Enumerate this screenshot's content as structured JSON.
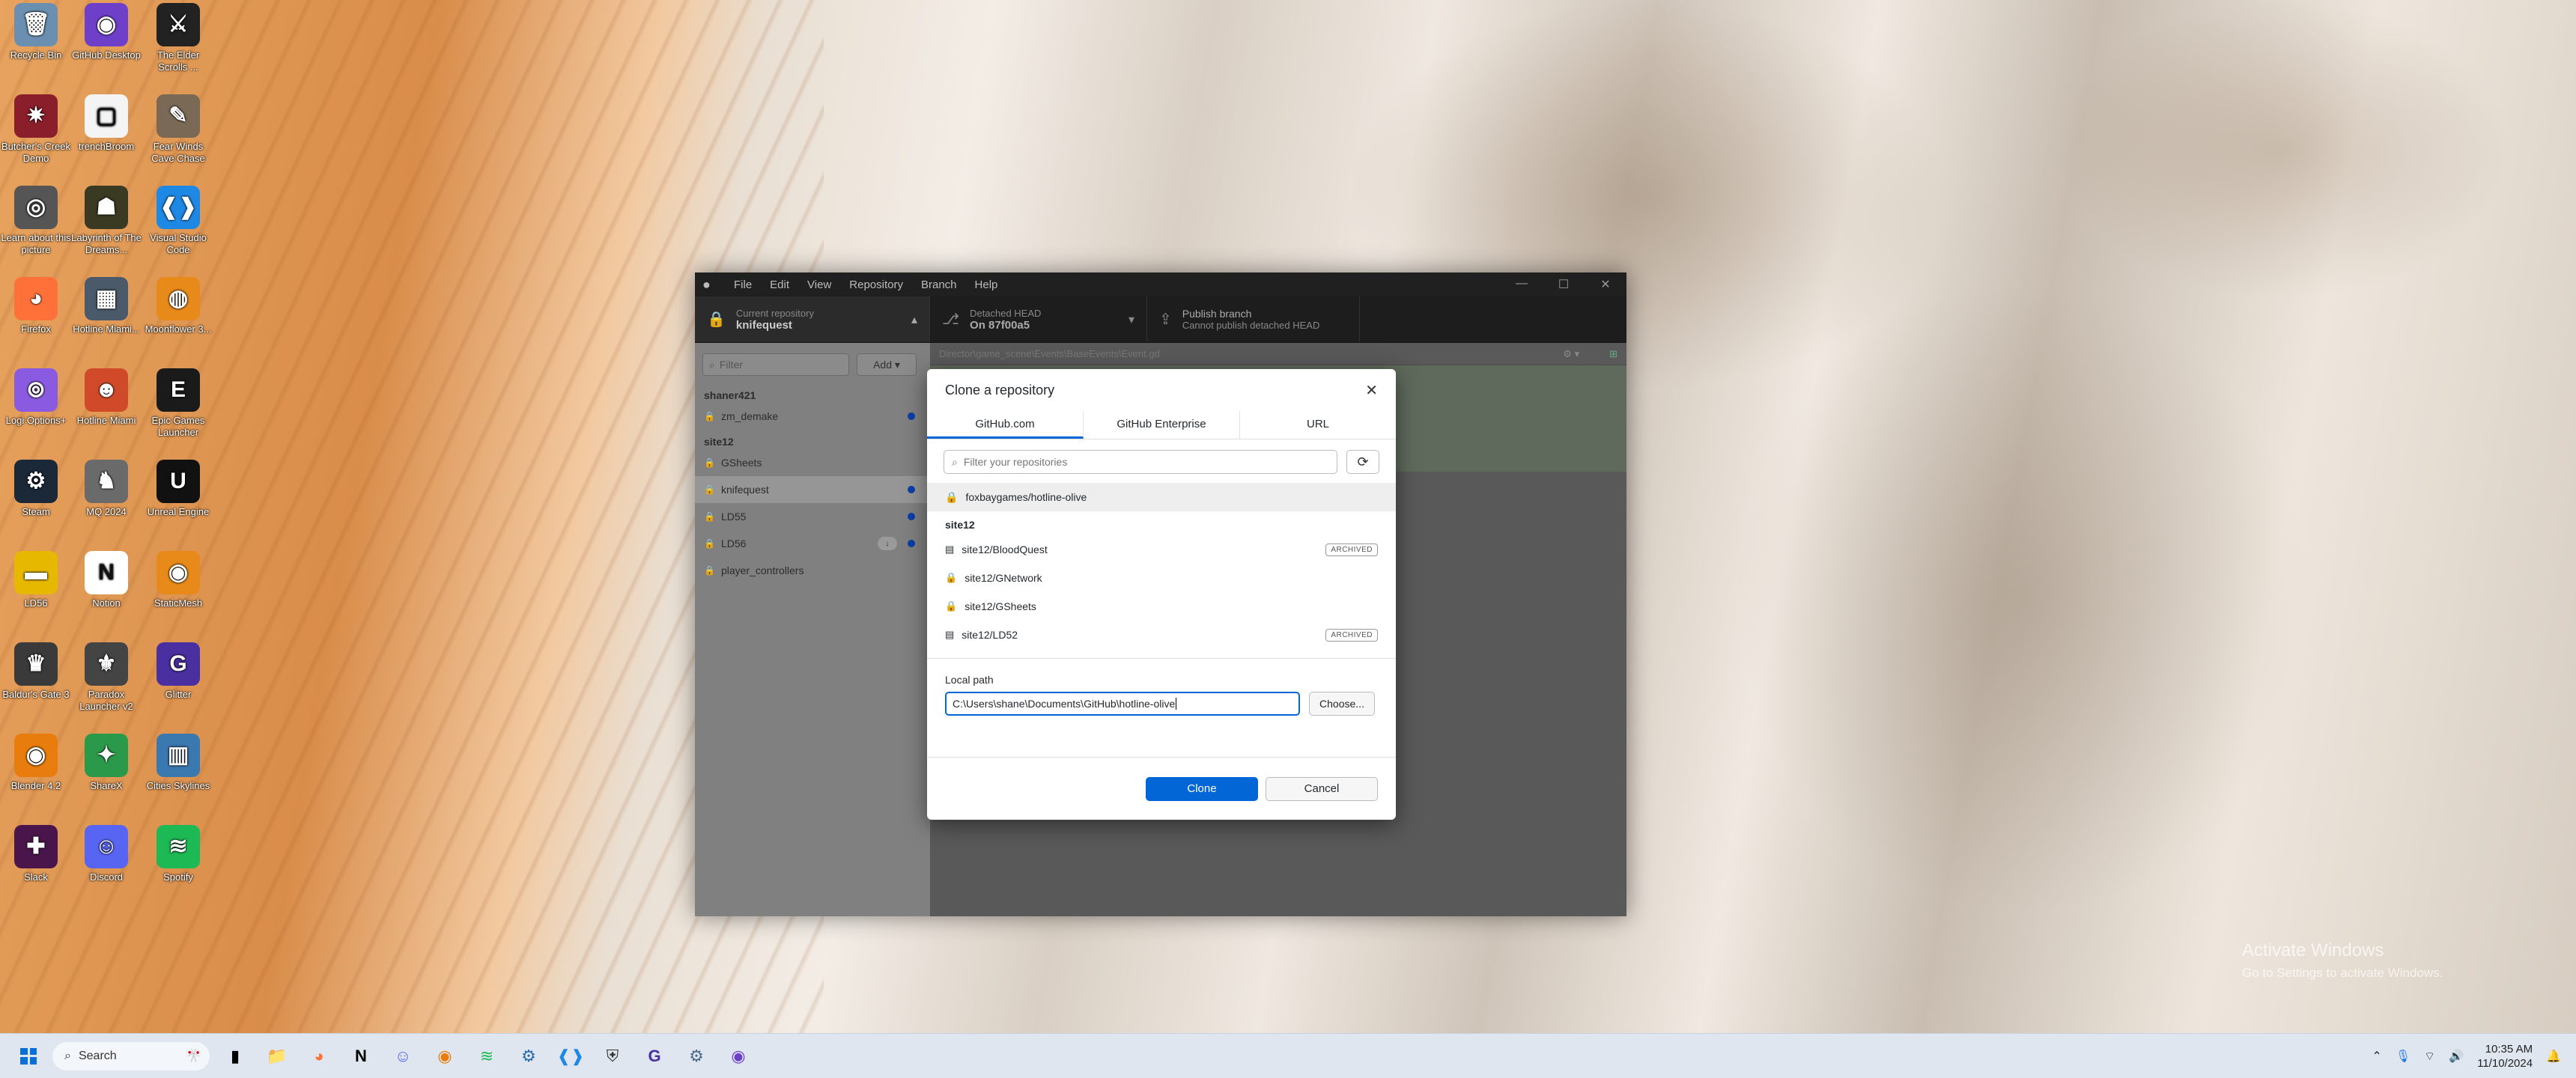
{
  "desktop": {
    "icons": [
      {
        "label": "Recycle Bin",
        "glyph": "🗑",
        "color": "#6a8fb0"
      },
      {
        "label": "GitHub Desktop",
        "glyph": "◉",
        "color": "#6e40c9"
      },
      {
        "label": "The Elder Scrolls ...",
        "glyph": "⚔",
        "color": "#222"
      },
      {
        "label": "Butcher's Creek Demo",
        "glyph": "✷",
        "color": "#8a1f2b"
      },
      {
        "label": "trenchBroom",
        "glyph": "▢",
        "color": "#f4f4f4"
      },
      {
        "label": "Fear Winds Cave Chase",
        "glyph": "✎",
        "color": "#7a6a55"
      },
      {
        "label": "Learn about this picture",
        "glyph": "◎",
        "color": "#555"
      },
      {
        "label": "Labyrinth of The Dreams...",
        "glyph": "☗",
        "color": "#3a3a22"
      },
      {
        "label": "Visual Studio Code",
        "glyph": "❰❱",
        "color": "#1e88e5"
      },
      {
        "label": "Firefox",
        "glyph": "◕",
        "color": "#ff7139"
      },
      {
        "label": "Hotline Miami...",
        "glyph": "▦",
        "color": "#4a5a6a"
      },
      {
        "label": "Moonflower 3...",
        "glyph": "◍",
        "color": "#e88a1a"
      },
      {
        "label": "Logi Options+",
        "glyph": "⊚",
        "color": "#8a5be0"
      },
      {
        "label": "Hotline Miami",
        "glyph": "☻",
        "color": "#d04a2a"
      },
      {
        "label": "Epic Games Launcher",
        "glyph": "E",
        "color": "#1a1a1a"
      },
      {
        "label": "Steam",
        "glyph": "⚙",
        "color": "#1b2838"
      },
      {
        "label": "MQ 2024",
        "glyph": "♞",
        "color": "#6a6a6a"
      },
      {
        "label": "Unreal Engine",
        "glyph": "U",
        "color": "#111"
      },
      {
        "label": "LD56",
        "glyph": "▬",
        "color": "#e6b800"
      },
      {
        "label": "Notion",
        "glyph": "N",
        "color": "#fff"
      },
      {
        "label": "StaticMesh",
        "glyph": "◉",
        "color": "#e88a1a"
      },
      {
        "label": "Baldur's Gate 3",
        "glyph": "♛",
        "color": "#3a3a3a"
      },
      {
        "label": "Paradox Launcher v2",
        "glyph": "⚜",
        "color": "#444"
      },
      {
        "label": "Glitter",
        "glyph": "G",
        "color": "#4a2fa0"
      },
      {
        "label": "Blender 4.2",
        "glyph": "◉",
        "color": "#e87d0d"
      },
      {
        "label": "ShareX",
        "glyph": "✦",
        "color": "#2a9a4a"
      },
      {
        "label": "Cities Skylines",
        "glyph": "▥",
        "color": "#3a78b0"
      },
      {
        "label": "Slack",
        "glyph": "✚",
        "color": "#4a154b"
      },
      {
        "label": "Discord",
        "glyph": "☺",
        "color": "#5865f2"
      },
      {
        "label": "Spotify",
        "glyph": "≋",
        "color": "#1db954"
      }
    ],
    "watermark_title": "Activate Windows",
    "watermark_sub": "Go to Settings to activate Windows."
  },
  "window": {
    "menu": [
      "File",
      "Edit",
      "View",
      "Repository",
      "Branch",
      "Help"
    ],
    "current_repo_label": "Current repository",
    "current_repo": "knifequest",
    "branch_label": "Detached HEAD",
    "branch_value": "On 87f00a5",
    "publish_label": "Publish branch",
    "publish_sub": "Cannot publish detached HEAD",
    "filter_placeholder": "Filter",
    "add_label": "Add",
    "path": "Director\\game_scene\\Events\\BaseEvents\\Event.gd",
    "groups": [
      {
        "name": "shaner421",
        "repos": [
          {
            "name": "zm_demake",
            "dot": true
          }
        ]
      },
      {
        "name": "site12",
        "repos": [
          {
            "name": "GSheets",
            "dot": false
          },
          {
            "name": "knifequest",
            "dot": true,
            "selected": true
          },
          {
            "name": "LD55",
            "dot": true
          },
          {
            "name": "LD56",
            "dot": true,
            "download": "↓"
          },
          {
            "name": "player_controllers",
            "dot": false
          }
        ]
      }
    ]
  },
  "dialog": {
    "title": "Clone a repository",
    "tabs": [
      "GitHub.com",
      "GitHub Enterprise",
      "URL"
    ],
    "filter_placeholder": "Filter your repositories",
    "highlighted_repo": "foxbaygames/hotline-olive",
    "group": "site12",
    "repos": [
      {
        "name": "site12/BloodQuest",
        "icon": "repo",
        "archived": "ARCHIVED"
      },
      {
        "name": "site12/GNetwork",
        "icon": "lock",
        "archived": ""
      },
      {
        "name": "site12/GSheets",
        "icon": "lock",
        "archived": ""
      },
      {
        "name": "site12/LD52",
        "icon": "repo",
        "archived": "ARCHIVED"
      }
    ],
    "local_path_label": "Local path",
    "local_path": "C:\\Users\\shane\\Documents\\GitHub\\hotline-olive",
    "choose_label": "Choose...",
    "clone_label": "Clone",
    "cancel_label": "Cancel"
  },
  "taskbar": {
    "search_placeholder": "Search",
    "time": "10:35 AM",
    "date": "11/10/2024"
  }
}
